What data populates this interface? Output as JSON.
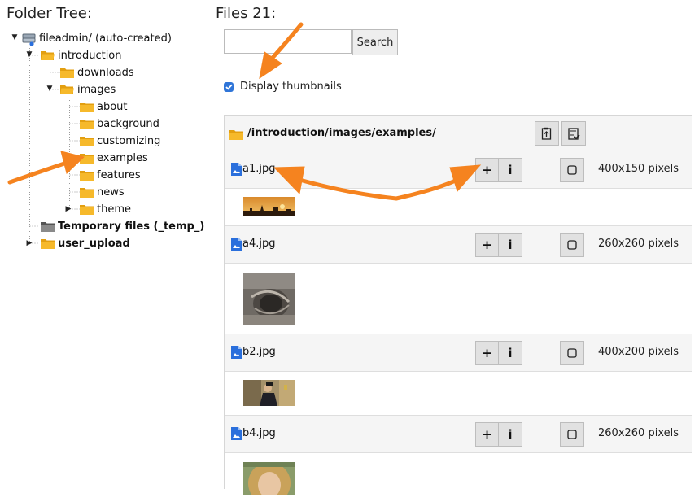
{
  "folder_tree": {
    "heading": "Folder Tree:",
    "root": {
      "label": "fileadmin/ (auto-created)",
      "expanded": true
    },
    "nodes": [
      {
        "label": "introduction",
        "expanded": true
      },
      {
        "label": "downloads"
      },
      {
        "label": "images",
        "expanded": true
      },
      {
        "label": "about"
      },
      {
        "label": "background"
      },
      {
        "label": "customizing"
      },
      {
        "label": "examples"
      },
      {
        "label": "features"
      },
      {
        "label": "news"
      },
      {
        "label": "theme",
        "expanded": false
      },
      {
        "label": "Temporary files (_temp_)"
      },
      {
        "label": "user_upload",
        "expanded": false
      }
    ]
  },
  "files": {
    "heading": "Files 21:",
    "search": {
      "value": "",
      "placeholder": "",
      "button_label": "Search"
    },
    "thumbnails": {
      "label": "Display thumbnails",
      "checked": true
    },
    "path": "/introduction/images/examples/",
    "rows": [
      {
        "name": "a1.jpg",
        "dimensions": "400x150 pixels",
        "add": "+",
        "info": "i"
      },
      {
        "name": "a4.jpg",
        "dimensions": "260x260 pixels",
        "add": "+",
        "info": "i"
      },
      {
        "name": "b2.jpg",
        "dimensions": "400x200 pixels",
        "add": "+",
        "info": "i"
      },
      {
        "name": "b4.jpg",
        "dimensions": "260x260 pixels",
        "add": "+",
        "info": "i"
      }
    ]
  },
  "colors": {
    "folder": "#f6b92b",
    "folder_dark": "#e39f10",
    "file_icon": "#2a6fdc",
    "annotation_arrow": "#f5831f",
    "checkbox": "#2f75d8"
  }
}
